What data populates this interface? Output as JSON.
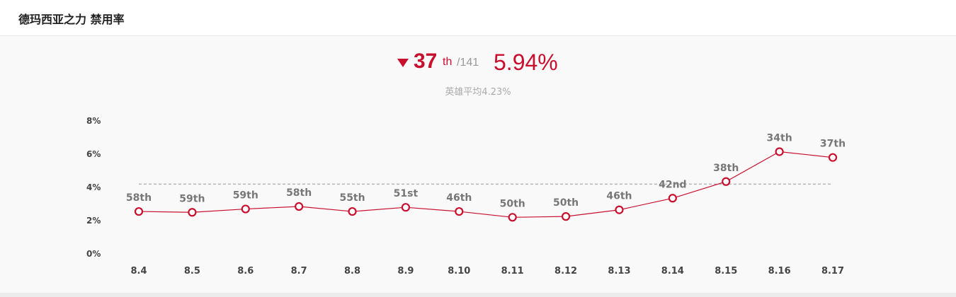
{
  "header": {
    "title": "德玛西亚之力 禁用率"
  },
  "summary": {
    "rank": "37",
    "rank_suffix": "th",
    "rank_total": "/141",
    "ban_rate": "5.94%",
    "average": "英雄平均4.23%",
    "trend": "down"
  },
  "colors": {
    "accent": "#c8102e",
    "average_line": "#999999",
    "label": "#777777"
  },
  "chart_data": {
    "type": "line",
    "categories": [
      "8.4",
      "8.5",
      "8.6",
      "8.7",
      "8.8",
      "8.9",
      "8.10",
      "8.11",
      "8.12",
      "8.13",
      "8.14",
      "8.15",
      "8.16",
      "8.17"
    ],
    "series": [
      {
        "values": [
          2.55,
          2.5,
          2.7,
          2.85,
          2.55,
          2.8,
          2.55,
          2.2,
          2.25,
          2.65,
          3.35,
          4.35,
          6.15,
          5.8
        ],
        "labels": [
          "58th",
          "59th",
          "59th",
          "58th",
          "55th",
          "51st",
          "46th",
          "50th",
          "50th",
          "46th",
          "42nd",
          "38th",
          "34th",
          "37th"
        ]
      }
    ],
    "average": 4.2,
    "yticks": [
      "0%",
      "2%",
      "4%",
      "6%",
      "8%"
    ],
    "ylim": [
      0,
      8
    ]
  }
}
